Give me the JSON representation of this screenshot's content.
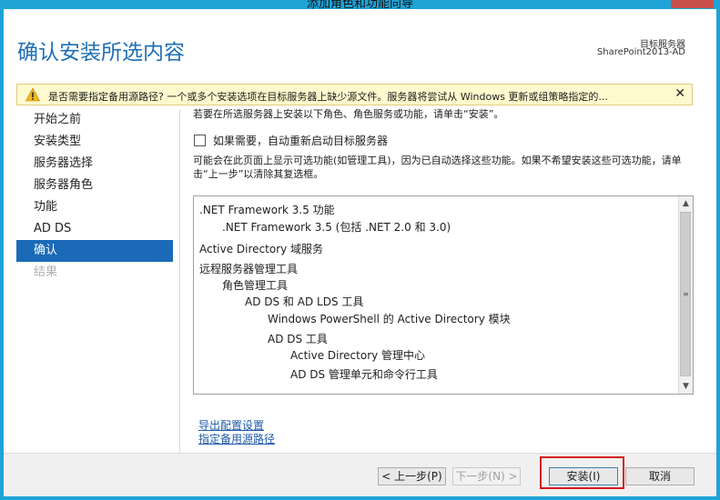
{
  "window": {
    "title": "添加角色和功能向导"
  },
  "header": {
    "page_title": "确认安装所选内容",
    "destination_label": "目标服务器",
    "destination_server": "SharePoint2013-AD"
  },
  "warning": {
    "text": "是否需要指定备用源路径? 一个或多个安装选项在目标服务器上缺少源文件。服务器将尝试从 Windows 更新或组策略指定的...",
    "close_glyph": "✕"
  },
  "sidebar": {
    "items": [
      {
        "label": "开始之前",
        "state": "normal"
      },
      {
        "label": "安装类型",
        "state": "normal"
      },
      {
        "label": "服务器选择",
        "state": "normal"
      },
      {
        "label": "服务器角色",
        "state": "normal"
      },
      {
        "label": "功能",
        "state": "normal"
      },
      {
        "label": "AD DS",
        "state": "normal"
      },
      {
        "label": "确认",
        "state": "active"
      },
      {
        "label": "结果",
        "state": "disabled"
      }
    ]
  },
  "content": {
    "intro": "若要在所选服务器上安装以下角色、角色服务或功能，请单击“安装”。",
    "restart_label": "如果需要，自动重新启动目标服务器",
    "restart_checked": false,
    "note": "可能会在此页面上显示可选功能(如管理工具)，因为已自动选择这些功能。如果不希望安装这些可选功能，请单击“上一步”以清除其复选框。",
    "features": [
      {
        "label": ".NET Framework 3.5 功能",
        "level": 0
      },
      {
        "label": ".NET Framework 3.5 (包括 .NET 2.0 和 3.0)",
        "level": 1
      },
      {
        "label": "Active Directory 域服务",
        "level": 0
      },
      {
        "label": "远程服务器管理工具",
        "level": 0
      },
      {
        "label": "角色管理工具",
        "level": 1
      },
      {
        "label": "AD DS 和 AD LDS 工具",
        "level": 2
      },
      {
        "label": "Windows PowerShell 的 Active Directory 模块",
        "level": 3
      },
      {
        "label": "AD DS 工具",
        "level": 3
      },
      {
        "label": "Active Directory 管理中心",
        "level": 4
      },
      {
        "label": "AD DS 管理单元和命令行工具",
        "level": 4
      }
    ],
    "export_link": "导出配置设置",
    "source_link": "指定备用源路径"
  },
  "footer": {
    "prev_label": "< 上一步(P)",
    "next_label": "下一步(N) >",
    "install_label": "安装(I)",
    "cancel_label": "取消"
  },
  "colors": {
    "title_blue": "#1e6fb6",
    "nav_active": "#1a6ab8",
    "chrome": "#1fa3d6",
    "warning_bg": "#fffacd",
    "highlight_red": "#d51a1f",
    "link": "#1e5aa8"
  },
  "icons": {
    "warning": "warning-triangle-icon",
    "close": "close-icon",
    "scroll_up": "chevron-up-icon",
    "scroll_down": "chevron-down-icon"
  }
}
